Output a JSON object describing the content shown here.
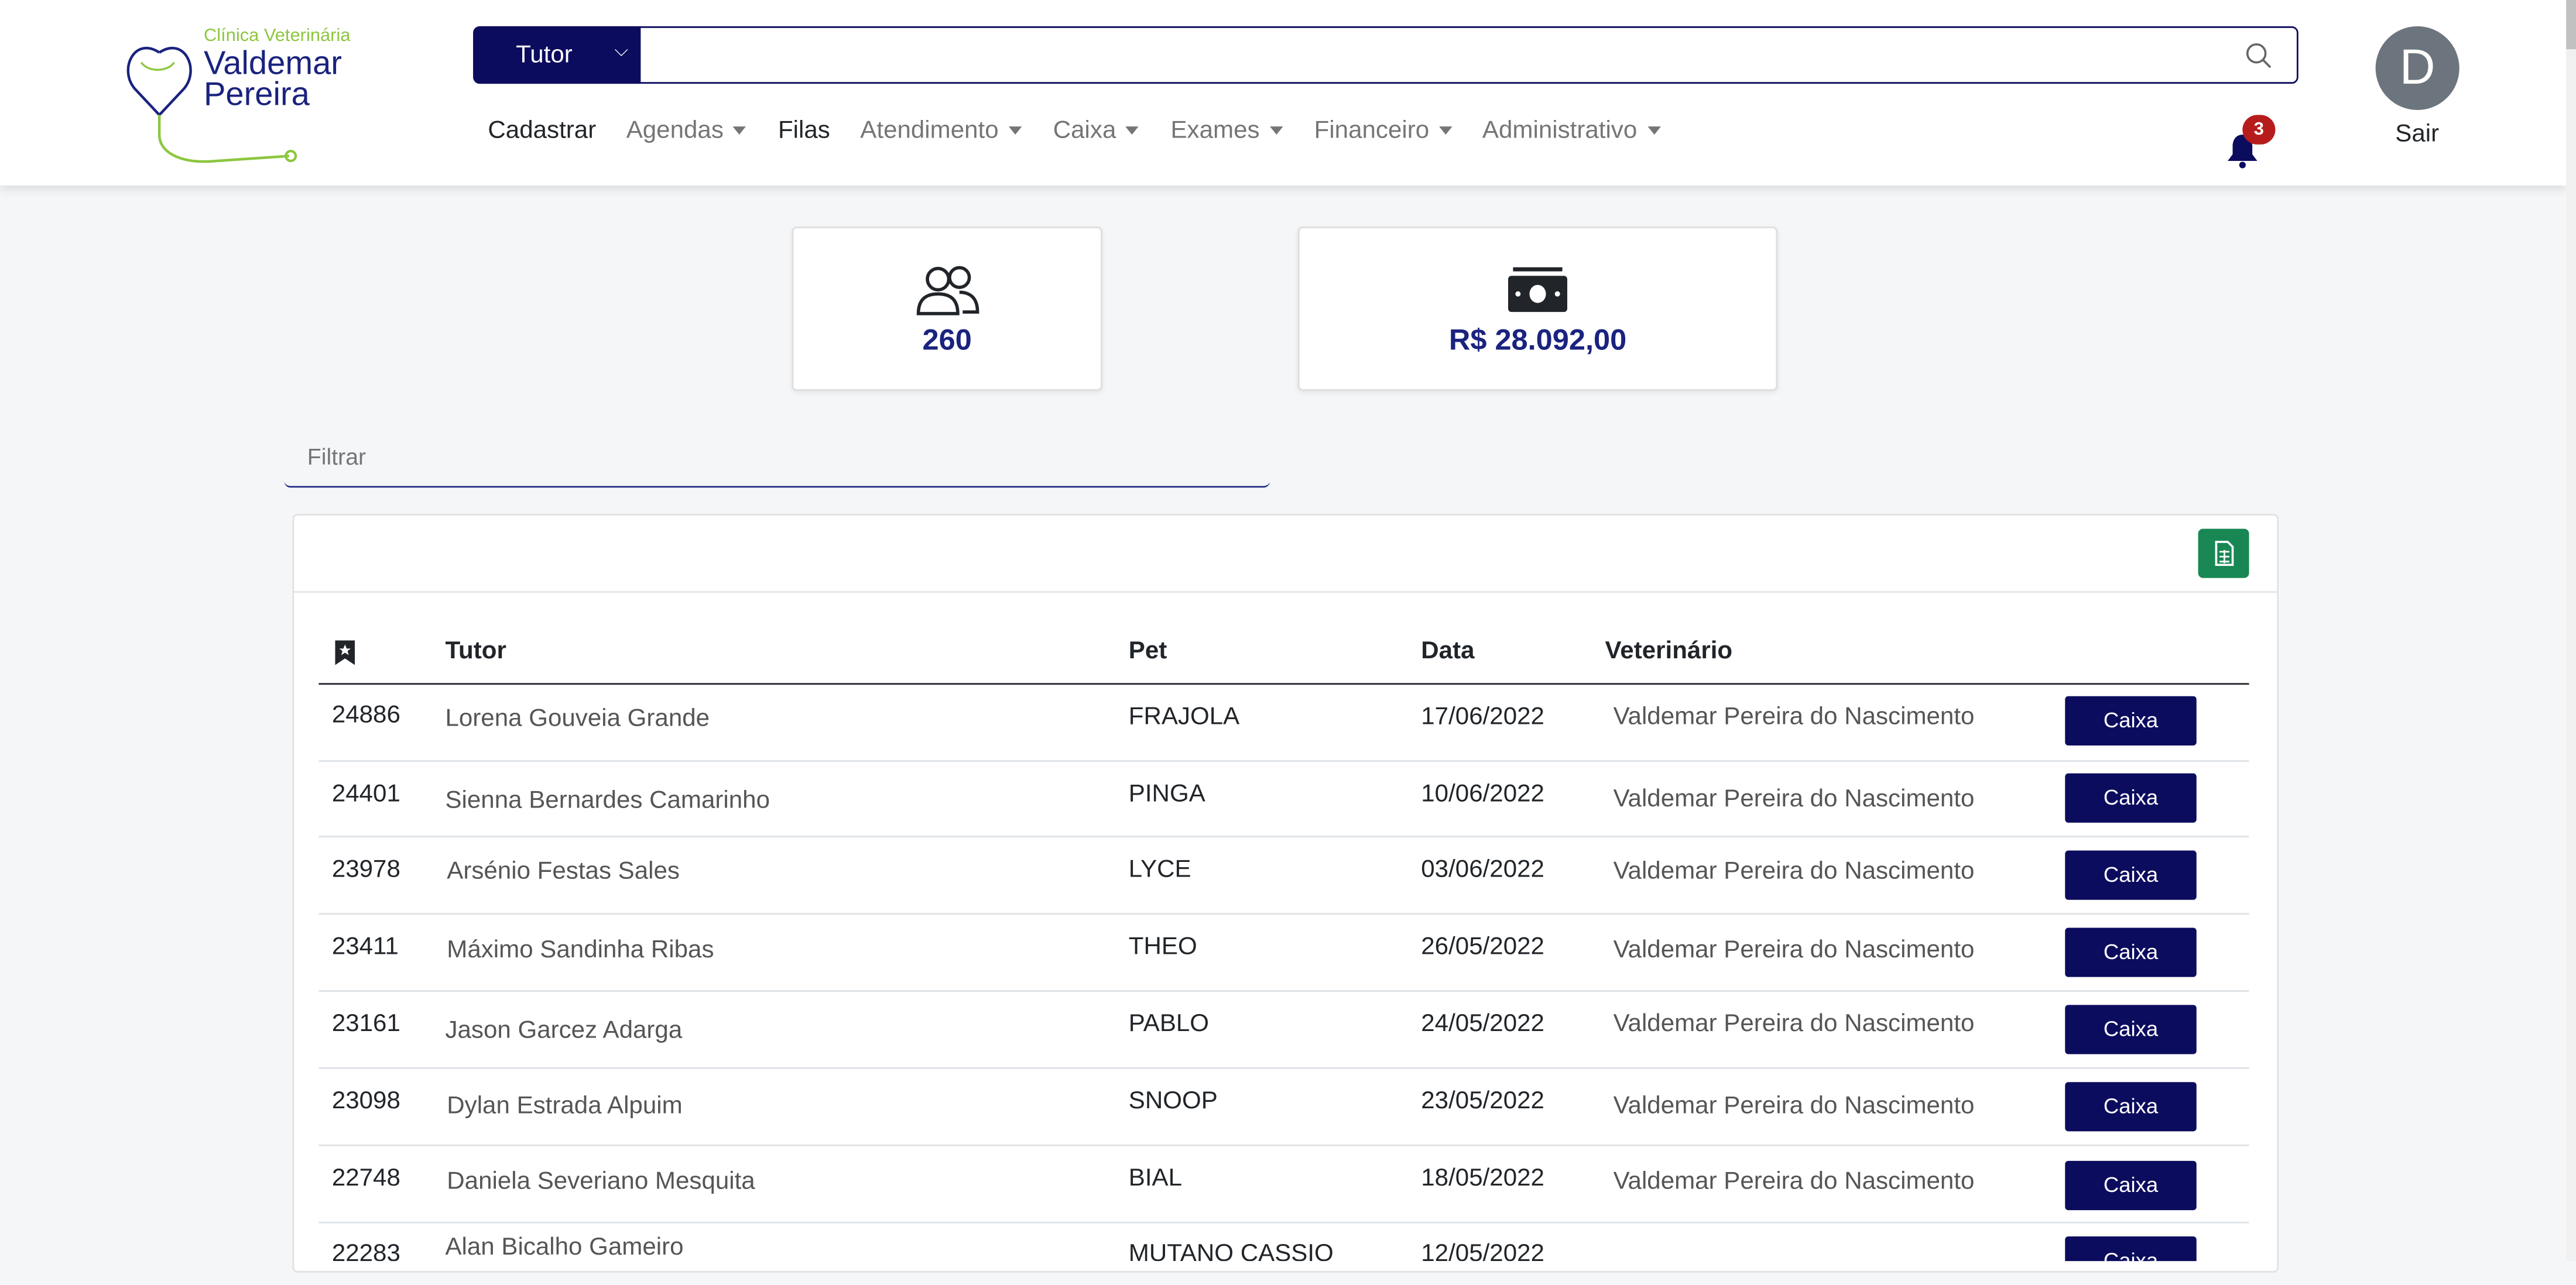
{
  "header": {
    "logo_small": "Clínica Veterinária",
    "logo_line1": "Valdemar",
    "logo_line2": "Pereira",
    "search_select": "Tutor",
    "nav": [
      "Cadastrar",
      "Agendas",
      "Filas",
      "Atendimento",
      "Caixa",
      "Exames",
      "Financeiro",
      "Administrativo"
    ],
    "notification_count": "3",
    "avatar_letter": "D",
    "logout_label": "Sair"
  },
  "stats": {
    "clients": "260",
    "revenue": "R$ 28.092,00"
  },
  "filter": {
    "placeholder": "Filtrar"
  },
  "table": {
    "columns": [
      "Tutor",
      "Pet",
      "Data",
      "Veterinário"
    ],
    "rows": [
      {
        "id": "24886",
        "tutor": "Lorena Gouveia Grande",
        "pet": "FRAJOLA",
        "date": "17/06/2022",
        "vet": "Valdemar Pereira do Nascimento",
        "action": "Caixa"
      },
      {
        "id": "24401",
        "tutor": "Sienna Bernardes Camarinho",
        "pet": "PINGA",
        "date": "10/06/2022",
        "vet": "Valdemar Pereira do Nascimento",
        "action": "Caixa"
      },
      {
        "id": "23978",
        "tutor": "Arsénio Festas Sales",
        "pet": "LYCE",
        "date": "03/06/2022",
        "vet": "Valdemar Pereira do Nascimento",
        "action": "Caixa"
      },
      {
        "id": "23411",
        "tutor": "Máximo Sandinha Ribas",
        "pet": "THEO",
        "date": "26/05/2022",
        "vet": "Valdemar Pereira do Nascimento",
        "action": "Caixa"
      },
      {
        "id": "23161",
        "tutor": "Jason Garcez Adarga",
        "pet": "PABLO",
        "date": "24/05/2022",
        "vet": "Valdemar Pereira do Nascimento",
        "action": "Caixa"
      },
      {
        "id": "23098",
        "tutor": "Dylan Estrada Alpuim",
        "pet": "SNOOP",
        "date": "23/05/2022",
        "vet": "Valdemar Pereira do Nascimento",
        "action": "Caixa"
      },
      {
        "id": "22748",
        "tutor": "Daniela Severiano Mesquita",
        "pet": "BIAL",
        "date": "18/05/2022",
        "vet": "Valdemar Pereira do Nascimento",
        "action": "Caixa"
      },
      {
        "id": "22283",
        "tutor": "Alan Bicalho Gameiro",
        "pet": "MUTANO CASSIO",
        "date": "12/05/2022",
        "vet": "",
        "action": "Caixa"
      }
    ]
  },
  "colors": {
    "primary": "#0c0c5e",
    "accent_green": "#198754",
    "logo_green": "#8dc63f",
    "badge_red": "#b71c1c"
  },
  "icons": {
    "search": "magnifier-icon",
    "bell": "bell-icon",
    "clients": "users-icon",
    "revenue": "money-icon",
    "export": "spreadsheet-icon",
    "bookmark": "bookmark-icon"
  }
}
